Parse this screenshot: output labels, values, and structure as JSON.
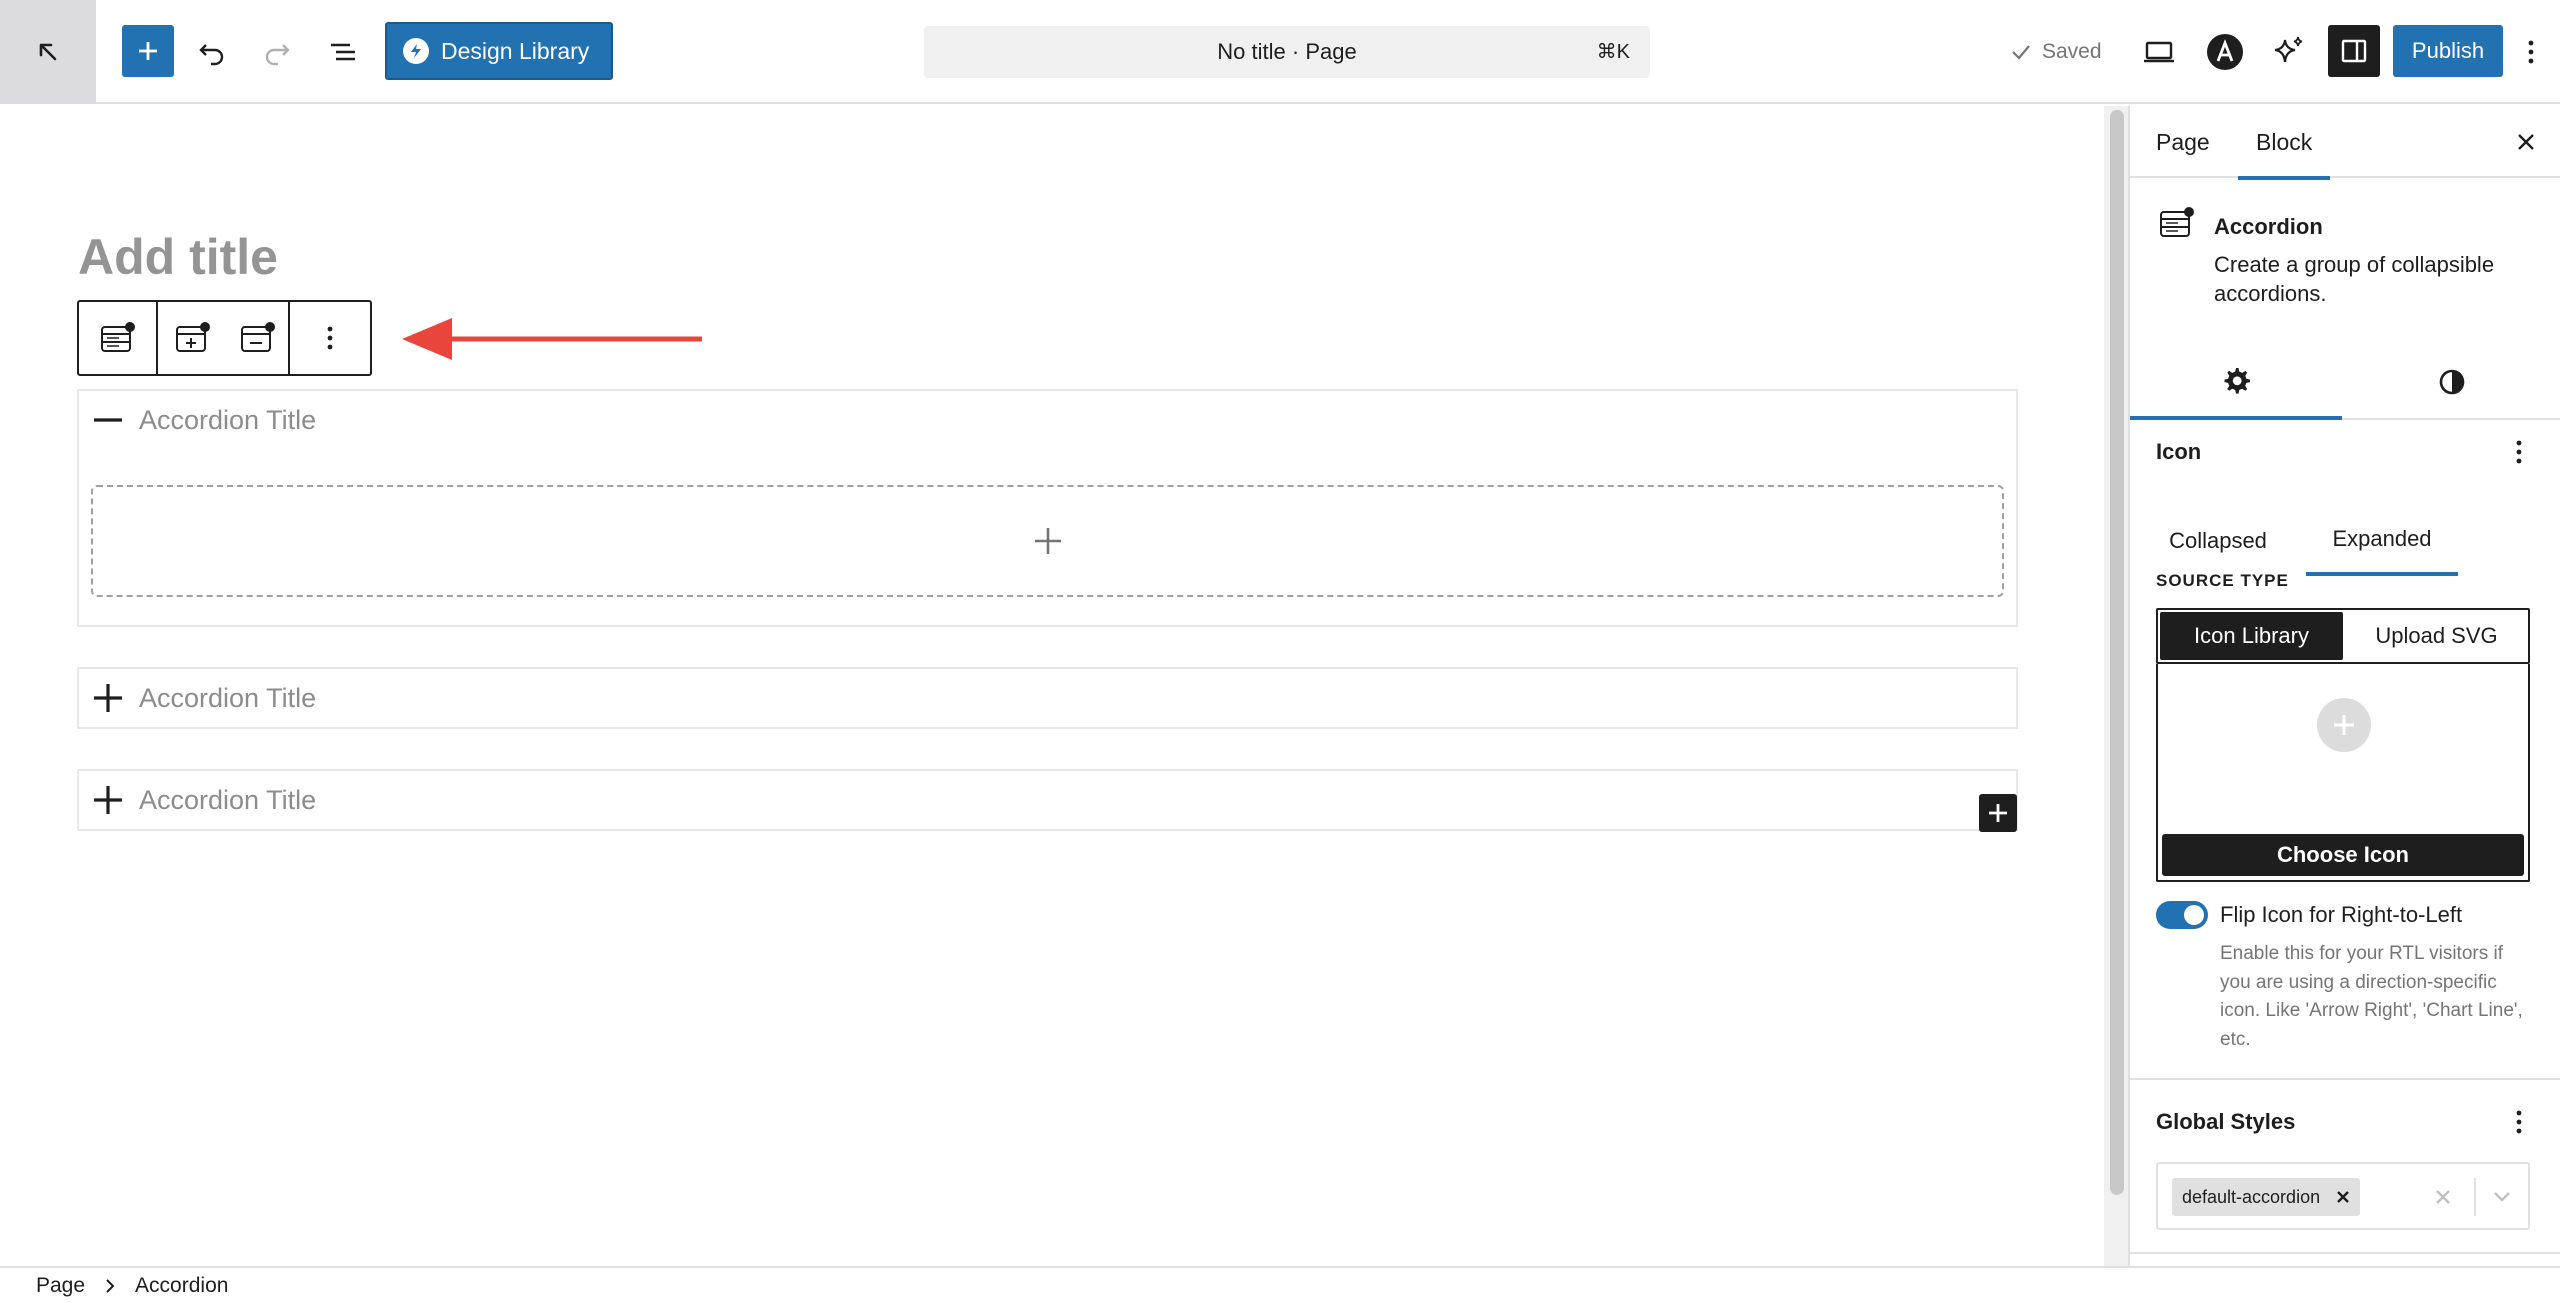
{
  "topbar": {
    "design_library_label": "Design Library",
    "document_title": "No title · Page",
    "shortcut": "⌘K",
    "saved_label": "Saved",
    "publish_label": "Publish"
  },
  "editor": {
    "title_placeholder": "Add title",
    "accordions": [
      {
        "title": "Accordion Title",
        "state": "expanded"
      },
      {
        "title": "Accordion Title",
        "state": "collapsed"
      },
      {
        "title": "Accordion Title",
        "state": "collapsed"
      }
    ]
  },
  "breadcrumb": {
    "items": [
      "Page",
      "Accordion"
    ]
  },
  "sidebar": {
    "tabs": [
      "Page",
      "Block"
    ],
    "active_tab": "Block",
    "block": {
      "name": "Accordion",
      "description": "Create a group of collapsible accordions."
    },
    "icon_panel": {
      "title": "Icon",
      "state_tabs": [
        "Collapsed",
        "Expanded"
      ],
      "active_state": "Expanded",
      "source_type_label": "SOURCE TYPE",
      "source_options": [
        "Icon Library",
        "Upload SVG"
      ],
      "active_source": "Icon Library",
      "choose_icon_label": "Choose Icon",
      "flip_label": "Flip Icon for Right-to-Left",
      "flip_on": true,
      "flip_help": "Enable this for your RTL visitors if you are using a direction-specific icon. Like 'Arrow Right', 'Chart Line', etc."
    },
    "global_styles": {
      "title": "Global Styles",
      "selected": "default-accordion"
    }
  },
  "colors": {
    "accent": "#2271b1",
    "dark": "#1e1e1e",
    "arrow": "#e8453c"
  }
}
